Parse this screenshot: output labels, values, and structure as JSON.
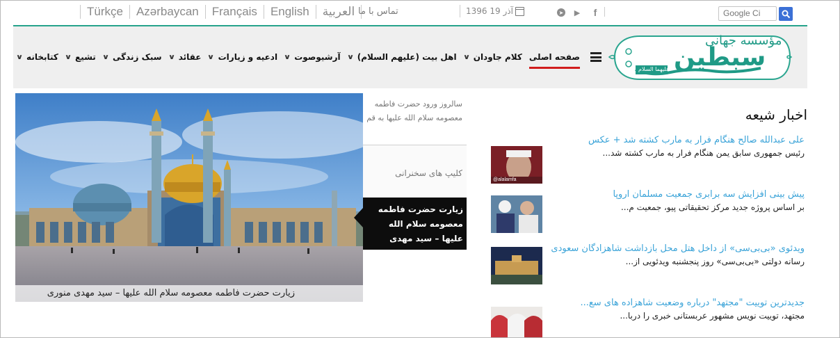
{
  "languages": [
    "Türkçe",
    "Azərbaycan",
    "Français",
    "English",
    "العربية"
  ],
  "contact_label": "تماس با ما",
  "date_text": "آذر 19 1396",
  "social": [
    "telegram-icon",
    "youtube-icon",
    "facebook-icon"
  ],
  "search": {
    "placeholder": "Google Ci"
  },
  "logo": {
    "line1": "مؤسسه جهانی",
    "main": "سبطین",
    "sub": "علیهما السلام"
  },
  "nav": [
    {
      "label": "صفحه اصلی",
      "has_menu": false,
      "active": true
    },
    {
      "label": "کلام جاودان",
      "has_menu": true
    },
    {
      "label": "اهل بیت (علیهم السلام)",
      "has_menu": true
    },
    {
      "label": "آرشیوصوت",
      "has_menu": true
    },
    {
      "label": "ادعیه و زیارات",
      "has_menu": true
    },
    {
      "label": "عقائد",
      "has_menu": true
    },
    {
      "label": "سبک زندگی",
      "has_menu": true
    },
    {
      "label": "تشیع",
      "has_menu": true
    },
    {
      "label": "کتابخانه",
      "has_menu": true
    }
  ],
  "slider": {
    "caption": "زیارت حضرت فاطمه معصومه سلام الله علیها – سید مهدی منوری",
    "thumbs": [
      "سالروز ورود حضرت فاطمه معصومه سلام الله علیها به قم",
      "کلیپ های سخنرانی",
      "زیارت حضرت فاطمه معصومه سلام الله علیها – سید مهدی منوری"
    ]
  },
  "news": {
    "section_title": "اخبار شیعه",
    "items": [
      {
        "title": "علی عبدالله صالح هنگام فرار به مارب کشته شد + عکس",
        "summary": "رئیس جمهوری سابق یمن هنگام فرار به مارب کشته شد...",
        "thumb_watermark": "@alalamfa"
      },
      {
        "title": "پیش بینی افزایش سه برابری جمعیت مسلمان اروپا",
        "summary": "بر اساس پروژه جدید مرکز تحقیقاتی پیو، جمعیت م..."
      },
      {
        "title": "ویدئوی «بی‌بی‌سی» از داخل هتل محل بازداشت شاهزادگان سعودی",
        "summary": "رسانه دولتی «بی‌بی‌سی» روز پنجشنبه ویدئویی از..."
      },
      {
        "title": "جدیدترین توییت \"مجتهد\" درباره وضعیت شاهزاده های سع...",
        "summary": "مجتهد، توییت نویس مشهور عربستانی خبری را دربا..."
      }
    ]
  },
  "colors": {
    "accent_teal": "#26a38b",
    "link_blue": "#3aa3d8",
    "active_red": "#d11d1d"
  }
}
